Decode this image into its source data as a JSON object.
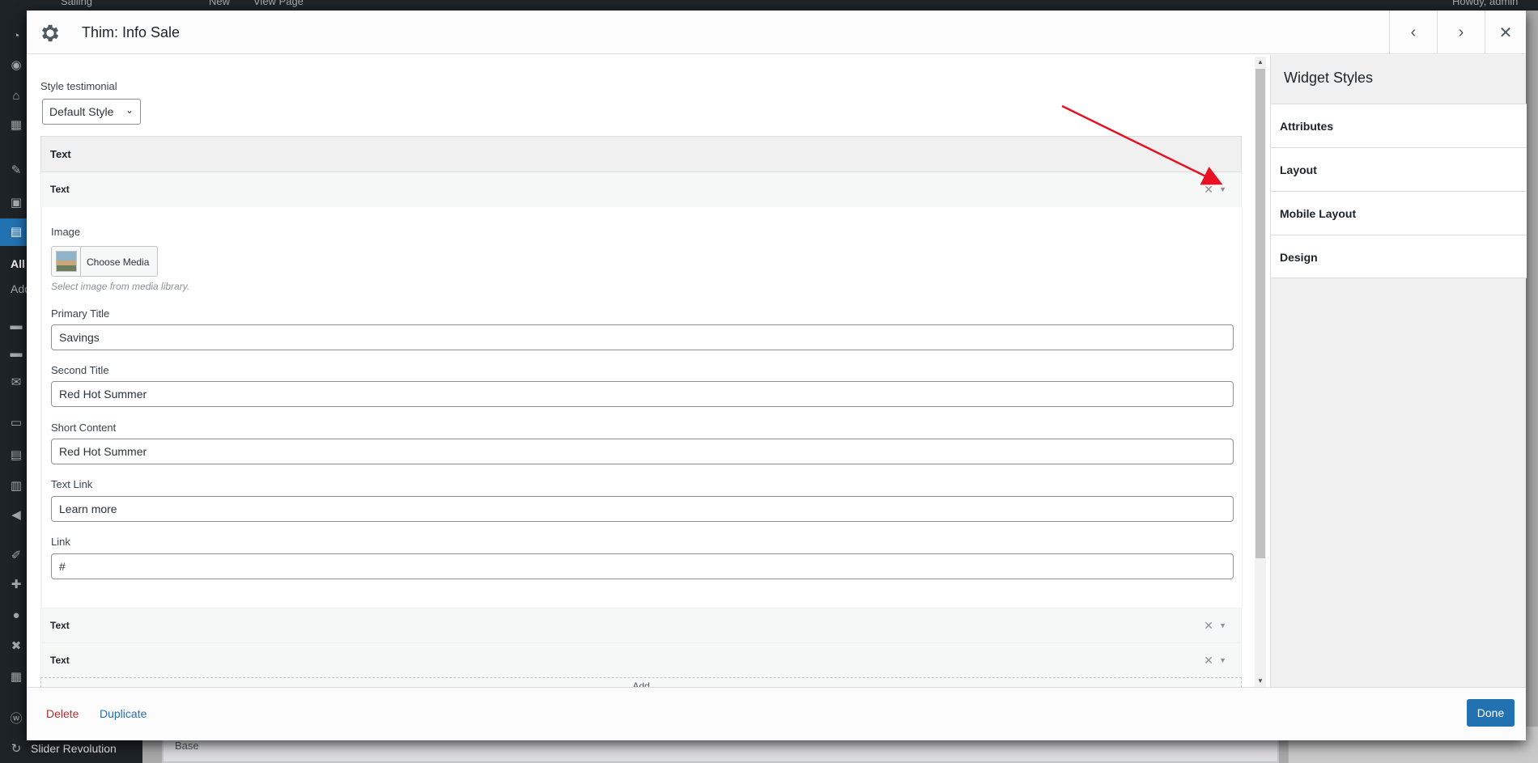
{
  "admin_bar": {
    "site_name": "Sailing",
    "new_label": "New",
    "view_page_label": "View Page",
    "howdy": "Howdy, admin"
  },
  "admin_menu": {
    "all_label": "All",
    "add_label": "Add",
    "slider_revolution_label": "Slider Revolution"
  },
  "background": {
    "base_label": "Base"
  },
  "modal": {
    "title": "Thim: Info Sale",
    "header_icon": "gear-icon",
    "prev_icon": "chevron-left-icon",
    "next_icon": "chevron-right-icon",
    "close_icon": "close-icon"
  },
  "form": {
    "style_label": "Style testimonial",
    "style_value": "Default Style",
    "repeater_label": "Text",
    "items": [
      {
        "title": "Text",
        "expanded": true
      },
      {
        "title": "Text",
        "expanded": false
      },
      {
        "title": "Text",
        "expanded": false
      }
    ],
    "fields": {
      "image_label": "Image",
      "choose_media_label": "Choose Media",
      "image_hint": "Select image from media library.",
      "primary_title_label": "Primary Title",
      "primary_title_value": "Savings",
      "second_title_label": "Second Title",
      "second_title_value": "Red Hot Summer",
      "short_content_label": "Short Content",
      "short_content_value": "Red Hot Summer",
      "text_link_label": "Text Link",
      "text_link_value": "Learn more",
      "link_label": "Link",
      "link_value": "#"
    },
    "add_label": "Add"
  },
  "sidebar": {
    "title": "Widget Styles",
    "sections": [
      "Attributes",
      "Layout",
      "Mobile Layout",
      "Design"
    ]
  },
  "footer": {
    "delete_label": "Delete",
    "duplicate_label": "Duplicate",
    "done_label": "Done"
  },
  "colors": {
    "accent": "#2271b1",
    "danger": "#b32d2e",
    "annotation_arrow": "#e81123"
  }
}
